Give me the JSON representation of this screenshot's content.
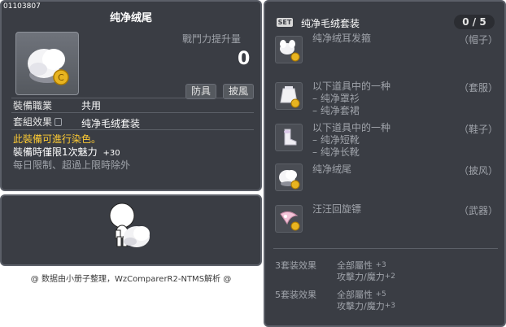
{
  "item": {
    "id": "01103807",
    "title": "纯净绒尾",
    "power_label": "戰鬥力提升量",
    "power_value": "0",
    "tags": [
      "防具",
      "披風"
    ],
    "job_label": "裝備職業",
    "job_value": "共用",
    "set_label": "套組效果",
    "set_value": "纯净毛绒套装",
    "dye_note": "此裝備可進行染色。",
    "bonus_line": "裝備時僅限1次魅力",
    "bonus_value": "+30",
    "limit_note": "每日限制、超過上限時除外"
  },
  "caption": "@ 数据由小册子整理，WzComparerR2-NTMS解析 @",
  "set": {
    "badge": "SET",
    "title": "纯净毛绒套装",
    "count": "0 / 5",
    "items": [
      {
        "name": "纯净绒耳发箍",
        "sub": [],
        "type": "（帽子）",
        "icon": "hat-icon"
      },
      {
        "name": "以下道具中的一种",
        "sub": [
          "– 纯净罩衫",
          "– 纯净套裙"
        ],
        "type": "（套服）",
        "icon": "outfit-icon"
      },
      {
        "name": "以下道具中的一种",
        "sub": [
          "– 纯净短靴",
          "– 纯净长靴"
        ],
        "type": "（鞋子）",
        "icon": "shoes-icon"
      },
      {
        "name": "纯净绒尾",
        "sub": [],
        "type": "（披风）",
        "icon": "tail-icon"
      },
      {
        "name": "汪汪回旋镖",
        "sub": [],
        "type": "（武器）",
        "icon": "boomerang-icon"
      }
    ],
    "effects": [
      {
        "label": "3套装效果",
        "lines": [
          {
            "text": "全部屬性",
            "value": "+3"
          },
          {
            "text": "攻擊力/魔力",
            "value": "+2"
          }
        ]
      },
      {
        "label": "5套装效果",
        "lines": [
          {
            "text": "全部屬性",
            "value": "+5"
          },
          {
            "text": "攻擊力/魔力",
            "value": "+3"
          }
        ]
      }
    ]
  },
  "colors": {
    "panel_bg": "#3a3d44",
    "highlight_yellow": "#ffcc33",
    "muted": "#9fa3aa"
  }
}
